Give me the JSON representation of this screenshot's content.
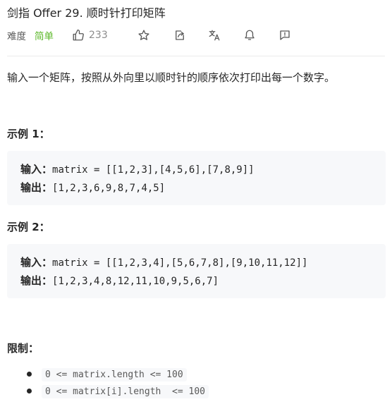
{
  "problem": {
    "title": "剑指 Offer 29. 顺时针打印矩阵",
    "difficulty_label": "难度",
    "difficulty": "简单",
    "likes": "233",
    "colors": {
      "easy": "#5ab726",
      "text": "#262626",
      "muted": "#8c8c8c",
      "code_bg": "#f7f8fa"
    }
  },
  "toolbar": {
    "icons": [
      "thumb-up-icon",
      "star-icon",
      "share-icon",
      "translate-icon",
      "bell-icon",
      "feedback-icon"
    ]
  },
  "description": "输入一个矩阵，按照从外向里以顺时针的顺序依次打印出每一个数字。",
  "examples": [
    {
      "heading": "示例 1：",
      "input_label": "输入：",
      "input": "matrix = [[1,2,3],[4,5,6],[7,8,9]]",
      "output_label": "输出：",
      "output": "[1,2,3,6,9,8,7,4,5]"
    },
    {
      "heading": "示例 2：",
      "input_label": "输入：",
      "input": "matrix = [[1,2,3,4],[5,6,7,8],[9,10,11,12]]",
      "output_label": "输出：",
      "output": "[1,2,3,4,8,12,11,10,9,5,6,7]"
    }
  ],
  "constraints": {
    "heading": "限制：",
    "items": [
      "0 <= matrix.length <= 100",
      "0 <= matrix[i].length  <= 100"
    ]
  }
}
